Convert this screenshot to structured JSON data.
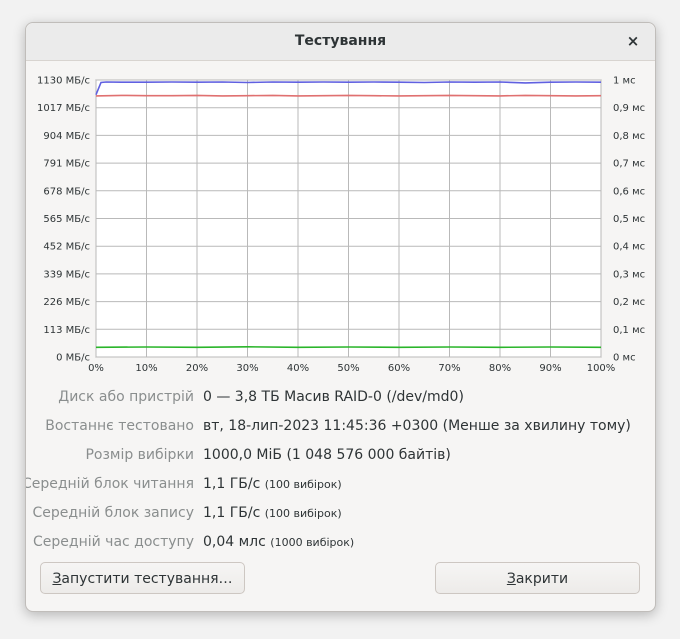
{
  "window": {
    "title": "Тестування",
    "close_icon": "×"
  },
  "chart_data": {
    "type": "line",
    "title": "",
    "x_ticks": [
      "0%",
      "10%",
      "20%",
      "30%",
      "40%",
      "50%",
      "60%",
      "70%",
      "80%",
      "90%",
      "100%"
    ],
    "left_ticks": [
      "0 МБ/с",
      "113 МБ/с",
      "226 МБ/с",
      "339 МБ/с",
      "452 МБ/с",
      "565 МБ/с",
      "678 МБ/с",
      "791 МБ/с",
      "904 МБ/с",
      "1017 МБ/с",
      "1130 МБ/с"
    ],
    "right_ticks": [
      "0 мс",
      "0,1 мс",
      "0,2 мс",
      "0,3 мс",
      "0,4 мс",
      "0,5 мс",
      "0,6 мс",
      "0,7 мс",
      "0,8 мс",
      "0,9 мс",
      "1 мс"
    ],
    "x_range": [
      0,
      100
    ],
    "ylim": [
      0,
      1130
    ],
    "y2lim": [
      0,
      1
    ],
    "grid": true,
    "series": [
      {
        "color": "#6060e0",
        "axis": "left",
        "x": [
          0,
          1,
          2,
          5,
          10,
          15,
          20,
          25,
          30,
          35,
          40,
          45,
          50,
          55,
          60,
          65,
          70,
          75,
          80,
          85,
          90,
          95,
          100
        ],
        "values": [
          1070,
          1120,
          1122,
          1121,
          1121,
          1122,
          1121,
          1122,
          1120,
          1122,
          1121,
          1122,
          1121,
          1122,
          1121,
          1120,
          1122,
          1121,
          1122,
          1118,
          1121,
          1122,
          1121
        ]
      },
      {
        "color": "#e07070",
        "axis": "left",
        "x": [
          0,
          5,
          10,
          15,
          20,
          25,
          30,
          35,
          40,
          45,
          50,
          55,
          60,
          65,
          70,
          75,
          80,
          85,
          90,
          95,
          100
        ],
        "values": [
          1065,
          1067,
          1066,
          1066,
          1067,
          1065,
          1066,
          1067,
          1065,
          1066,
          1067,
          1066,
          1065,
          1066,
          1067,
          1066,
          1065,
          1067,
          1066,
          1065,
          1066
        ]
      },
      {
        "color": "#2ab52a",
        "axis": "right",
        "x": [
          0,
          10,
          20,
          30,
          40,
          50,
          60,
          70,
          80,
          90,
          100
        ],
        "values": [
          0.035,
          0.036,
          0.035,
          0.037,
          0.035,
          0.036,
          0.035,
          0.036,
          0.035,
          0.036,
          0.035
        ]
      }
    ]
  },
  "info": {
    "device_label": "Диск або пристрій",
    "device_value": "0 — 3,8 ТБ Масив RAID-0 (/dev/md0)",
    "tested_label": "Востаннє тестовано",
    "tested_value": "вт, 18-лип-2023 11:45:36 +0300 (Менше за хвилину тому)",
    "sample_label": "Розмір вибірки",
    "sample_value": "1000,0 МіБ (1 048 576 000 байтів)",
    "read_label": "Середній блок читання",
    "read_value": "1,1 ГБ/с",
    "read_note": "(100 вибірок)",
    "write_label": "Середній блок запису",
    "write_value": "1,1 ГБ/с",
    "write_note": "(100 вибірок)",
    "access_label": "Середній час доступу",
    "access_value": "0,04 млс",
    "access_note": "(1000 вибірок)"
  },
  "buttons": {
    "start_mnemonic": "З",
    "start_label": "апустити тестування…",
    "close_mnemonic": "З",
    "close_label": "акрити"
  }
}
